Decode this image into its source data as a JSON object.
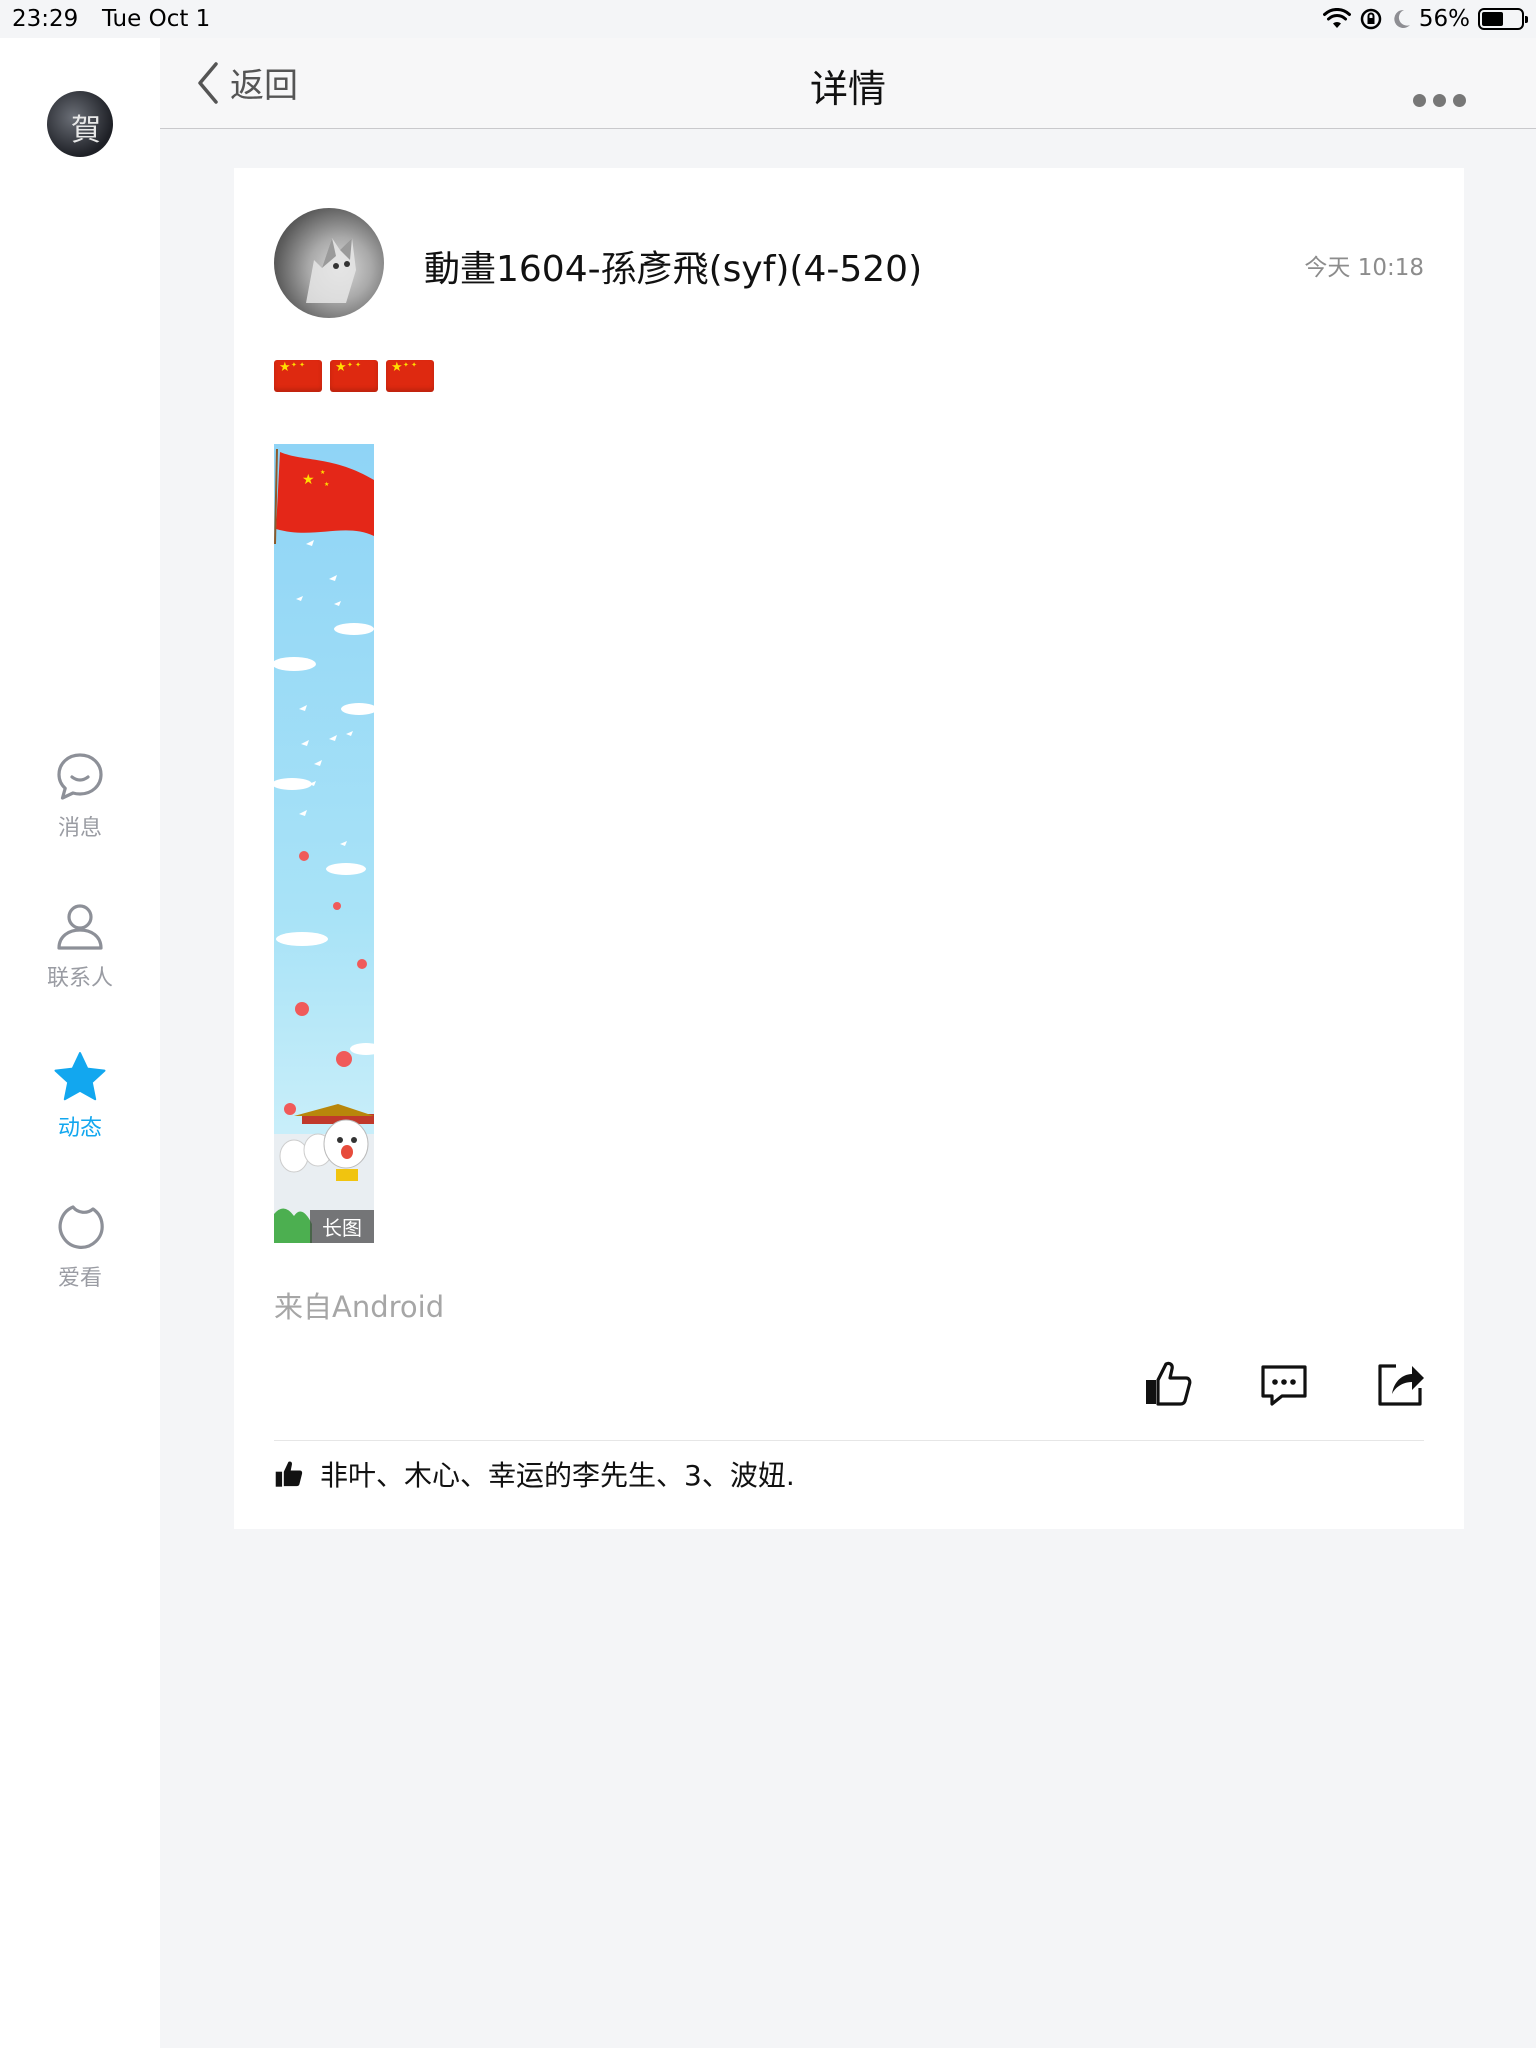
{
  "status_bar": {
    "time": "23:29",
    "date": "Tue Oct 1",
    "battery_text": "56%",
    "battery_level": 0.56
  },
  "sidebar": {
    "items": [
      {
        "label": "消息",
        "icon": "message-icon",
        "active": false
      },
      {
        "label": "联系人",
        "icon": "contacts-icon",
        "active": false
      },
      {
        "label": "动态",
        "icon": "star-icon",
        "active": true
      },
      {
        "label": "爱看",
        "icon": "watch-icon",
        "active": false
      }
    ]
  },
  "header": {
    "back_label": "返回",
    "title": "详情"
  },
  "post": {
    "author": "動畫1604-孫彥飛(syf)(4-520)",
    "time": "今天 10:18",
    "text_icons": [
      "cn-flag-icon",
      "cn-flag-icon",
      "cn-flag-icon"
    ],
    "image_badge": "长图",
    "source": "来自Android",
    "likes": "非叶、木心、幸运的李先生、3、波妞."
  },
  "colors": {
    "accent": "#12a7ef",
    "background": "#f4f5f7",
    "card": "#ffffff",
    "flag_red": "#de2910",
    "flag_yellow": "#ffde00"
  }
}
